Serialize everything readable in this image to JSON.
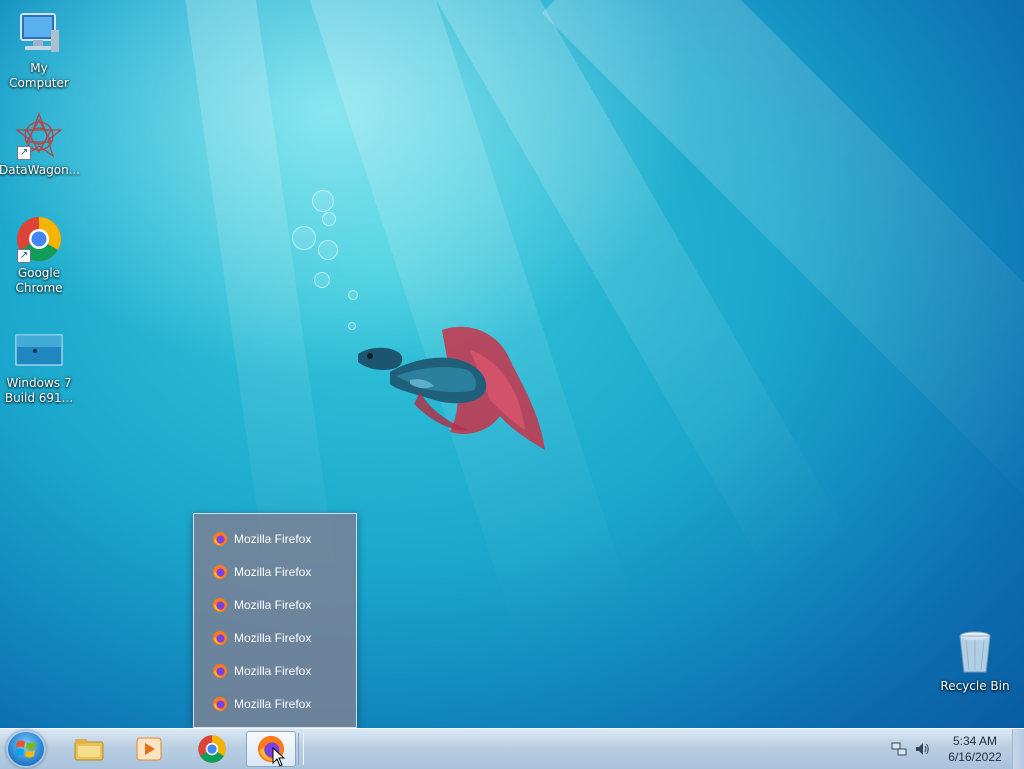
{
  "desktop": {
    "icons": [
      {
        "label": "My Computer",
        "icon": "computer-icon"
      },
      {
        "label": "DataWagon...",
        "icon": "datawagon-icon",
        "shortcut": true
      },
      {
        "label": "Google Chrome",
        "icon": "chrome-icon",
        "shortcut": true
      },
      {
        "label": "Windows 7 Build 691...",
        "icon": "windows-image-icon"
      },
      {
        "label": "Recycle Bin",
        "icon": "recycle-bin-icon"
      }
    ]
  },
  "jumplist": {
    "items": [
      {
        "label": "Mozilla Firefox",
        "icon": "firefox-icon"
      },
      {
        "label": "Mozilla Firefox",
        "icon": "firefox-icon"
      },
      {
        "label": "Mozilla Firefox",
        "icon": "firefox-icon"
      },
      {
        "label": "Mozilla Firefox",
        "icon": "firefox-icon"
      },
      {
        "label": "Mozilla Firefox",
        "icon": "firefox-icon"
      },
      {
        "label": "Mozilla Firefox",
        "icon": "firefox-icon"
      }
    ]
  },
  "taskbar": {
    "pinned": [
      {
        "icon": "file-explorer-icon"
      },
      {
        "icon": "media-player-icon"
      },
      {
        "icon": "chrome-icon"
      },
      {
        "icon": "firefox-icon",
        "active": true
      }
    ],
    "tray": {
      "time": "5:34 AM",
      "date": "6/16/2022",
      "icons": [
        "network-icon",
        "volume-icon"
      ]
    }
  },
  "colors": {
    "accent": "#1aa6cc",
    "taskbar": "#b9cfe3",
    "jumplist_bg": "#7882a0"
  }
}
